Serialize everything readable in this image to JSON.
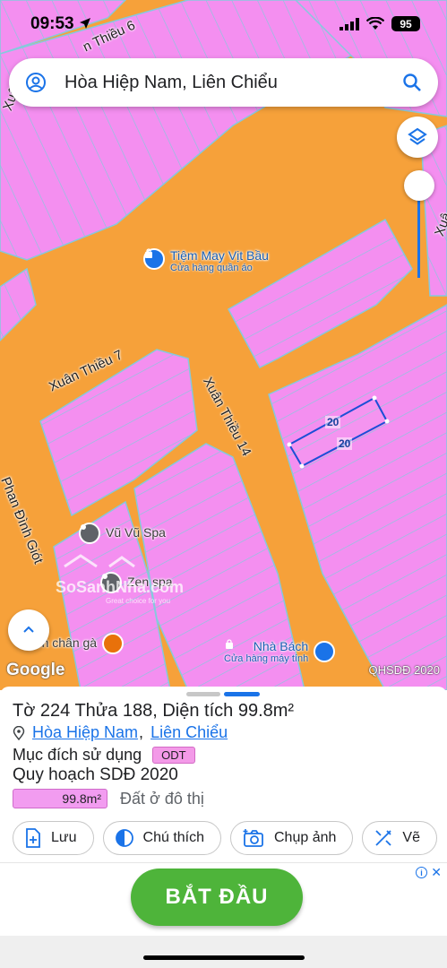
{
  "status_bar": {
    "time": "09:53",
    "battery": "95"
  },
  "search": {
    "text": "Hòa Hiệp Nam, Liên Chiểu"
  },
  "map": {
    "streets": {
      "top": "n Thiều 6",
      "top_left": "Xuân",
      "right": "Xuâ",
      "xuan_thieu_7": "Xuân Thiều 7",
      "xuan_thieu_14": "Xuân Thiều 14",
      "phan_dinh_giot": "Phan Đình Giót"
    },
    "pois": [
      {
        "name": "Tiệm May Vịt Bầu",
        "category": "Cửa hàng quần áo"
      },
      {
        "name": "Vũ Vũ Spa"
      },
      {
        "name": "Zen spa"
      },
      {
        "name": "uyền chân gà"
      },
      {
        "name": "Nhà Bách",
        "category": "Cửa hàng máy tính"
      }
    ],
    "parcel_dimensions": [
      "20",
      "20"
    ],
    "watermark": {
      "name": "SoSanhNha.com",
      "tagline": "Great choice for you"
    },
    "google_logo": "Google",
    "credit": "QHSDĐ 2020",
    "colors": {
      "road": "#f6a13a",
      "land": "#f48ff0",
      "lot_lines": "#86c9dd",
      "parcel": "#1b4fd6"
    }
  },
  "panel": {
    "title": "Tờ 224 Thửa 188, Diện tích 99.8m²",
    "address_ward": "Hòa Hiệp Nam",
    "address_sep": ",",
    "address_district": "Liên Chiểu",
    "usage_label": "Mục đích sử dụng",
    "usage_code": "ODT",
    "plan_title": "Quy hoạch SDĐ 2020",
    "plan_area": "99.8m²",
    "plan_type": "Đất ở đô thị",
    "actions": [
      {
        "label": "Lưu",
        "icon": "add-file-icon"
      },
      {
        "label": "Chú thích",
        "icon": "contrast-icon"
      },
      {
        "label": "Chụp ảnh",
        "icon": "camera-icon"
      },
      {
        "label": "Vẽ",
        "icon": "draw-icon"
      }
    ]
  },
  "ad": {
    "button": "BẮT ĐẦU",
    "info": "i",
    "close": "✕"
  }
}
